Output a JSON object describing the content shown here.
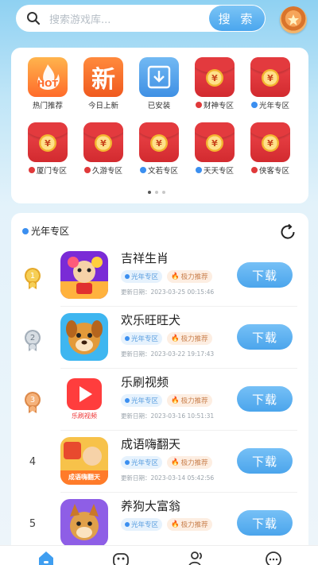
{
  "search": {
    "placeholder": "搜索游戏库...",
    "button_label": "搜 索"
  },
  "categories": [
    {
      "label": "热门推荐",
      "icon": "hot-icon",
      "dot": "",
      "badge_text": "HOT"
    },
    {
      "label": "今日上新",
      "icon": "new-icon",
      "dot": "",
      "badge_text": "新"
    },
    {
      "label": "已安装",
      "icon": "installed-icon",
      "dot": ""
    },
    {
      "label": "财神专区",
      "icon": "red-envelope-icon",
      "dot": "red"
    },
    {
      "label": "光年专区",
      "icon": "red-envelope-icon",
      "dot": "blue"
    },
    {
      "label": "厦门专区",
      "icon": "red-envelope-icon",
      "dot": "red"
    },
    {
      "label": "久游专区",
      "icon": "red-envelope-icon",
      "dot": "red"
    },
    {
      "label": "文若专区",
      "icon": "red-envelope-icon",
      "dot": "blue"
    },
    {
      "label": "天天专区",
      "icon": "red-envelope-icon",
      "dot": "blue"
    },
    {
      "label": "侠客专区",
      "icon": "red-envelope-icon",
      "dot": "red"
    }
  ],
  "coin_glyph": "¥",
  "list": {
    "title": "光年专区",
    "items": [
      {
        "rank": "1",
        "name": "吉祥生肖",
        "tag1": "光年专区",
        "tag2": "极力推荐",
        "date": "更新日期：2023-03-25 00:15:46",
        "button": "下载"
      },
      {
        "rank": "2",
        "name": "欢乐旺旺犬",
        "tag1": "光年专区",
        "tag2": "极力推荐",
        "date": "更新日期：2023-03-22 19:17:43",
        "button": "下载"
      },
      {
        "rank": "3",
        "name": "乐刷视频",
        "tag1": "光年专区",
        "tag2": "极力推荐",
        "date": "更新日期：2023-03-16 10:51:31",
        "button": "下载"
      },
      {
        "rank": "4",
        "name": "成语嗨翻天",
        "tag1": "光年专区",
        "tag2": "极力推荐",
        "date": "更新日期：2023-03-14 05:42:56",
        "button": "下载"
      },
      {
        "rank": "5",
        "name": "养狗大富翁",
        "tag1": "光年专区",
        "tag2": "极力推荐",
        "date": "",
        "button": "下载"
      }
    ]
  },
  "icon_texts": {
    "lesuashipin": "乐刷视频",
    "chengyu": "成语嗨翻天"
  },
  "colors": {
    "accent": "#4aa6ee",
    "red_envelope": "#e33a3e"
  }
}
